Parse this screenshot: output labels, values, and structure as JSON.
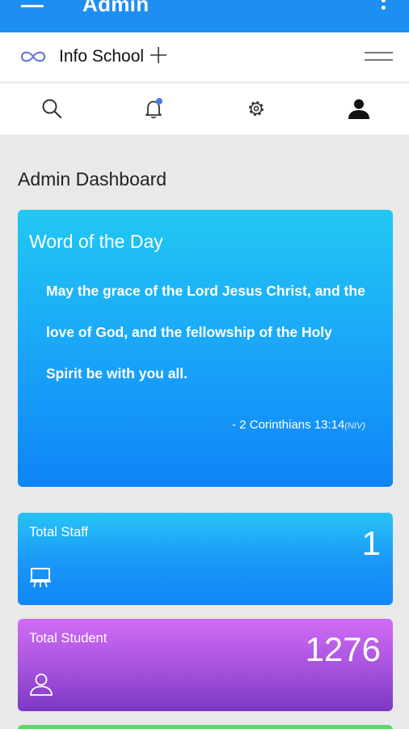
{
  "appbar": {
    "title": "Admin"
  },
  "brand": {
    "name": "Info School"
  },
  "iconbar": {
    "icons": [
      "search-icon",
      "bell-icon",
      "gear-icon",
      "user-icon"
    ]
  },
  "dashboard": {
    "title": "Admin Dashboard"
  },
  "verse": {
    "heading": "Word of the Day",
    "text": "May the grace of the Lord Jesus Christ, and the love of God, and the fellowship of the Holy Spirit be with you all.",
    "reference": "- 2 Corinthians 13:14",
    "version": "(NIV)"
  },
  "stats": {
    "staff": {
      "label": "Total Staff",
      "value": "1",
      "icon": "presentation-board-icon",
      "color": "#1a97f7"
    },
    "student": {
      "label": "Total Student",
      "value": "1276",
      "icon": "user-outline-icon",
      "color": "#a552dc"
    }
  },
  "colors": {
    "appbar": "#1e8ff2",
    "notification_dot": "#4b7bf0",
    "next_card": "#5ed66a"
  }
}
